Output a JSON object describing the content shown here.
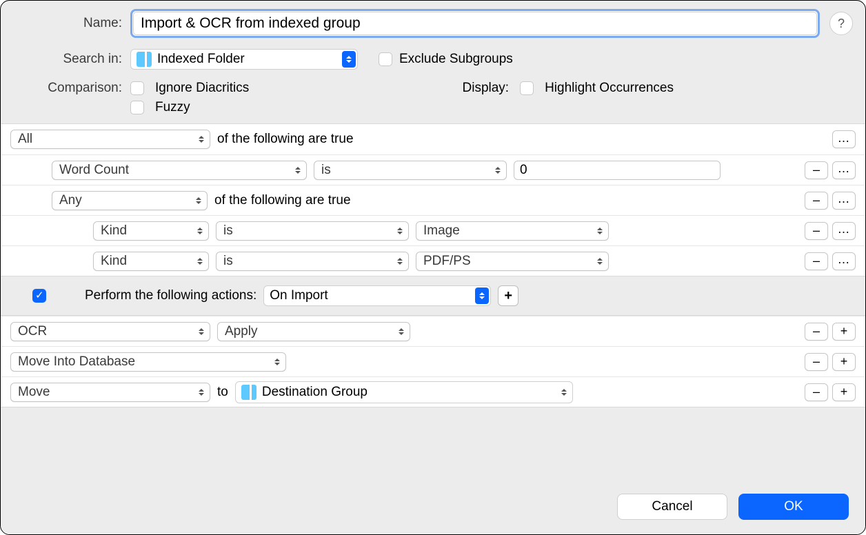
{
  "header": {
    "name_label": "Name:",
    "name_value": "Import & OCR from indexed group",
    "help_symbol": "?",
    "search_in_label": "Search in:",
    "search_in_value": "Indexed Folder",
    "exclude_subgroups_label": "Exclude Subgroups",
    "exclude_subgroups_checked": false,
    "comparison_label": "Comparison:",
    "ignore_diacritics_label": "Ignore Diacritics",
    "ignore_diacritics_checked": false,
    "fuzzy_label": "Fuzzy",
    "fuzzy_checked": false,
    "display_label": "Display:",
    "highlight_label": "Highlight Occurrences",
    "highlight_checked": false
  },
  "rules": {
    "root_quantifier": "All",
    "following_true": "of the following are true",
    "r1": {
      "field": "Word Count",
      "op": "is",
      "value": "0"
    },
    "nested_quantifier": "Any",
    "r2": {
      "field": "Kind",
      "op": "is",
      "value": "Image"
    },
    "r3": {
      "field": "Kind",
      "op": "is",
      "value": "PDF/PS"
    }
  },
  "actions_header": {
    "perform_label": "Perform the following actions:",
    "trigger": "On Import",
    "perform_checked": true
  },
  "actions": {
    "a1": {
      "name": "OCR",
      "param": "Apply"
    },
    "a2": {
      "name": "Move Into Database"
    },
    "a3": {
      "name": "Move",
      "to_label": "to",
      "destination": "Destination Group"
    }
  },
  "buttons": {
    "cancel": "Cancel",
    "ok": "OK",
    "minus": "–",
    "plus": "+"
  }
}
